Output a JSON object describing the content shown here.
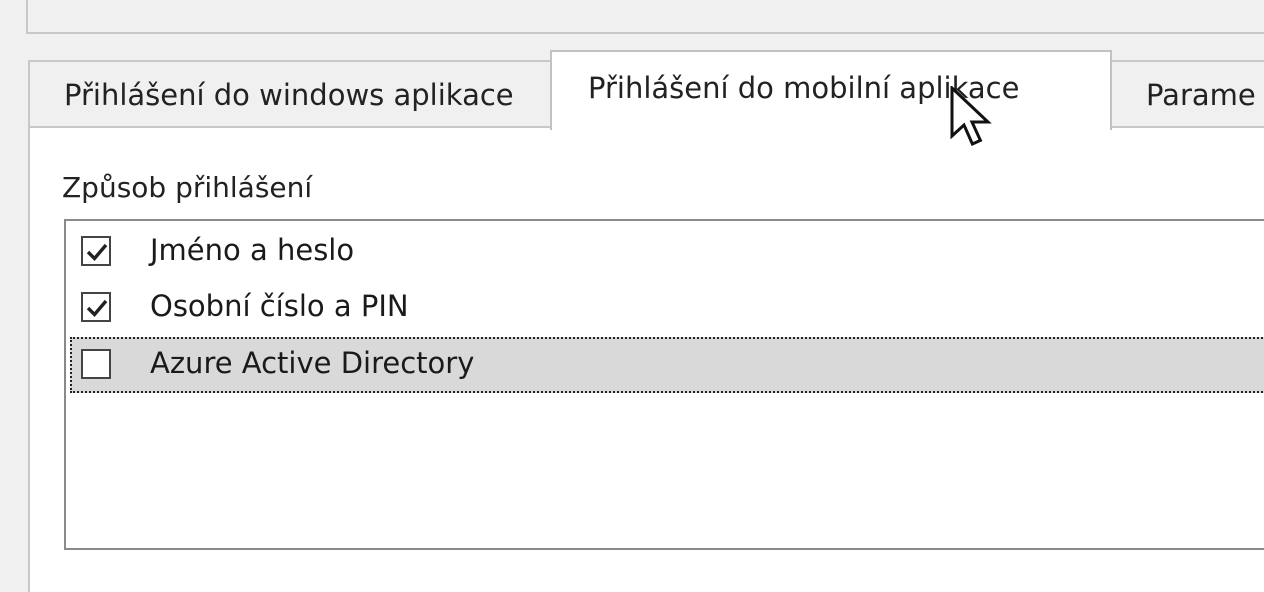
{
  "tabs": [
    {
      "label": "Přihlášení do windows aplikace",
      "active": false
    },
    {
      "label": "Přihlášení do mobilní aplikace",
      "active": true
    },
    {
      "label": "Parame",
      "active": false
    }
  ],
  "section": {
    "label": "Způsob přihlášení"
  },
  "login_methods": [
    {
      "label": "Jméno a heslo",
      "checked": true,
      "selected": false
    },
    {
      "label": "Osobní číslo a PIN",
      "checked": true,
      "selected": false
    },
    {
      "label": "Azure Active Directory",
      "checked": false,
      "selected": true
    }
  ],
  "icons": {
    "check": "checkmark-icon",
    "cursor": "mouse-pointer-icon"
  },
  "colors": {
    "background": "#f0f0f0",
    "panel": "#ffffff",
    "border": "#c8c8c8",
    "selected_row": "#d9d9d9"
  }
}
